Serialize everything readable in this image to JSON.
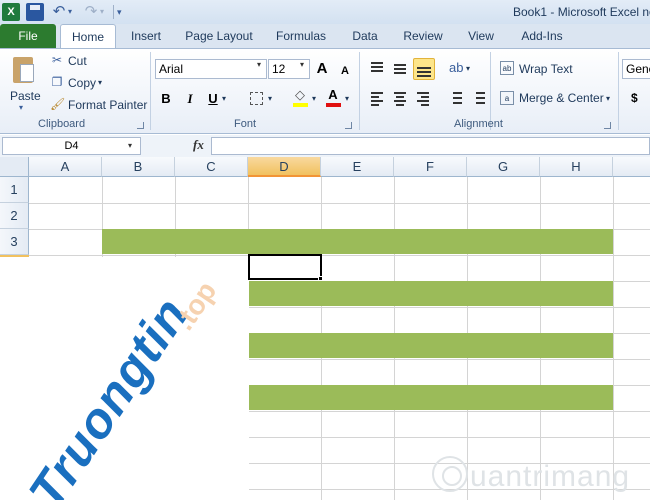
{
  "titlebar": {
    "app_icon_glyph": "X",
    "title": "Book1 - Microsoft Excel no",
    "undo_glyph": "↶",
    "redo_glyph": "↷",
    "dropdown_glyph": "▾",
    "customize_glyph": "▾"
  },
  "tabs": [
    {
      "label": "File",
      "active": false
    },
    {
      "label": "Home",
      "active": true
    },
    {
      "label": "Insert",
      "active": false
    },
    {
      "label": "Page Layout",
      "active": false
    },
    {
      "label": "Formulas",
      "active": false
    },
    {
      "label": "Data",
      "active": false
    },
    {
      "label": "Review",
      "active": false
    },
    {
      "label": "View",
      "active": false
    },
    {
      "label": "Add-Ins",
      "active": false
    }
  ],
  "ribbon": {
    "clipboard": {
      "label": "Clipboard",
      "paste": "Paste",
      "paste_drop": "▾",
      "cut": "Cut",
      "copy": "Copy",
      "copy_drop": "▾",
      "format_painter": "Format Painter"
    },
    "font": {
      "label": "Font",
      "name": "Arial",
      "size": "12",
      "drop": "▾",
      "grow": "A",
      "shrink": "A",
      "bold": "B",
      "italic": "I",
      "underline": "U",
      "fill_color": "#ffff00",
      "font_color": "#e01010"
    },
    "alignment": {
      "label": "Alignment",
      "wrap_text": "Wrap Text",
      "merge_center": "Merge & Center",
      "merge_drop": "▾"
    },
    "number": {
      "format": "Gene",
      "currency": "$",
      "currency_drop": "▾"
    }
  },
  "formula_bar": {
    "name_box": "D4",
    "drop": "▾",
    "fx": "fx",
    "formula": ""
  },
  "grid": {
    "columns": [
      "A",
      "B",
      "C",
      "D",
      "E",
      "F",
      "G",
      "H"
    ],
    "selected_column": "D",
    "rows": [
      "1",
      "2",
      "3"
    ],
    "active_cell": "D4",
    "fill_color": "#9bbb59"
  },
  "watermarks": {
    "main": "Truongtin",
    "tail": ".top",
    "secondary": "uantrimang"
  }
}
